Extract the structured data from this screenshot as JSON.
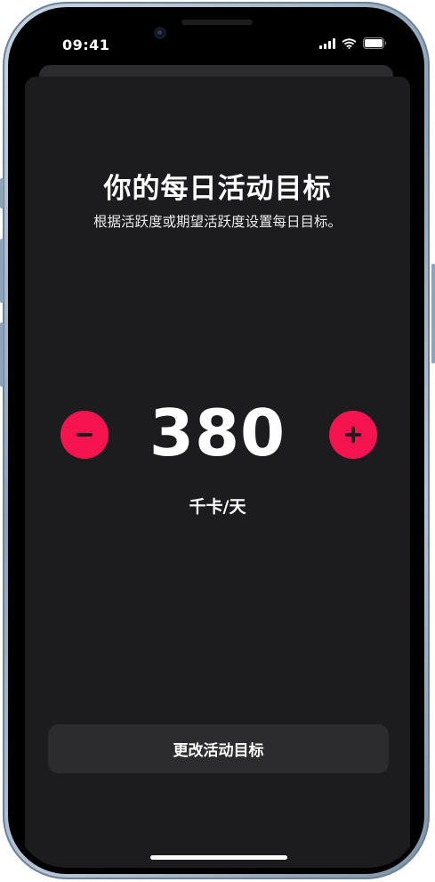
{
  "status_bar": {
    "time": "09:41",
    "icons": [
      "cellular-signal-icon",
      "wifi-icon",
      "battery-icon"
    ]
  },
  "goal_screen": {
    "title": "你的每日活动目标",
    "subtitle": "根据活跃度或期望活跃度设置每日目标。",
    "value": "380",
    "unit": "千卡/天",
    "change_button_label": "更改活动目标",
    "decrement_icon": "minus-icon",
    "increment_icon": "plus-icon"
  },
  "colors": {
    "accent": "#f5144f",
    "sheet_background": "#1c1c1e",
    "button_background": "#2c2c2e",
    "text": "#ffffff"
  }
}
